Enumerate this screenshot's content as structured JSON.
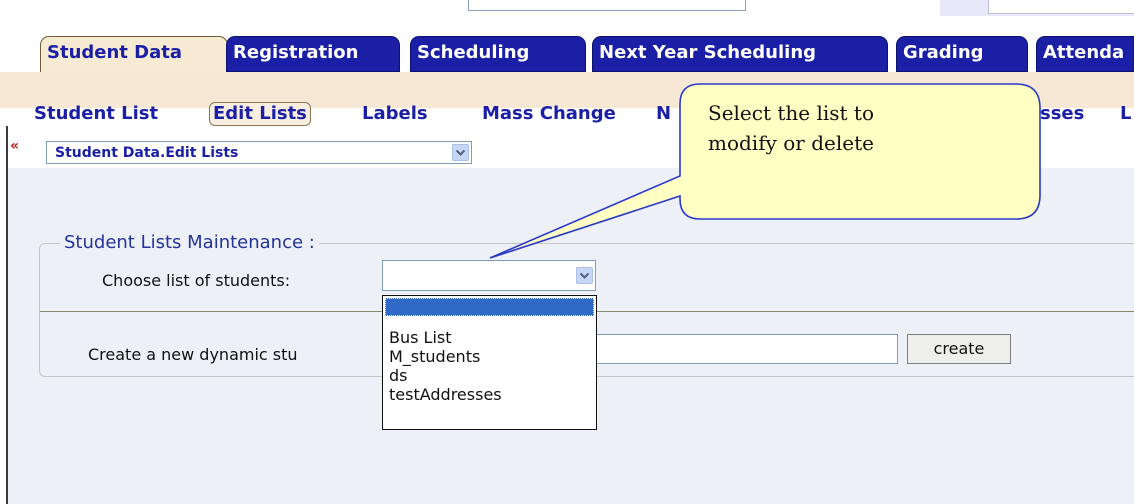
{
  "main_tabs": [
    "Student Data",
    "Registration",
    "Scheduling",
    "Next Year Scheduling",
    "Grading",
    "Attenda"
  ],
  "sub_nav": {
    "items": [
      "Student List",
      "Edit Lists",
      "Labels",
      "Mass Change",
      "N",
      "sses",
      "L"
    ]
  },
  "breadcrumb": {
    "collapse_icon": "«",
    "page_select_value": "Student Data.Edit Lists"
  },
  "form": {
    "legend": "Student Lists Maintenance :",
    "choose_label": "Choose list of students:",
    "choose_value": "",
    "create_label": "Create a new dynamic stu",
    "create_value": "",
    "create_button": "create"
  },
  "dropdown_options": [
    "",
    "Bus List",
    "M_students",
    "ds",
    "testAddresses"
  ],
  "callout": {
    "line1": "Select the list to",
    "line2": "modify or delete"
  },
  "colors": {
    "tab_blue": "#1a1fa6",
    "tab_active": "#f7ead2",
    "subbar": "#f6e8d4",
    "content_bg": "#eef0f8",
    "selected_option": "#3169c6",
    "callout_fill": "#ffffc4",
    "callout_border": "#2a3ac8"
  },
  "icons": {
    "collapse": "double-left-chevron-icon",
    "dropdown": "chevron-down-icon"
  }
}
